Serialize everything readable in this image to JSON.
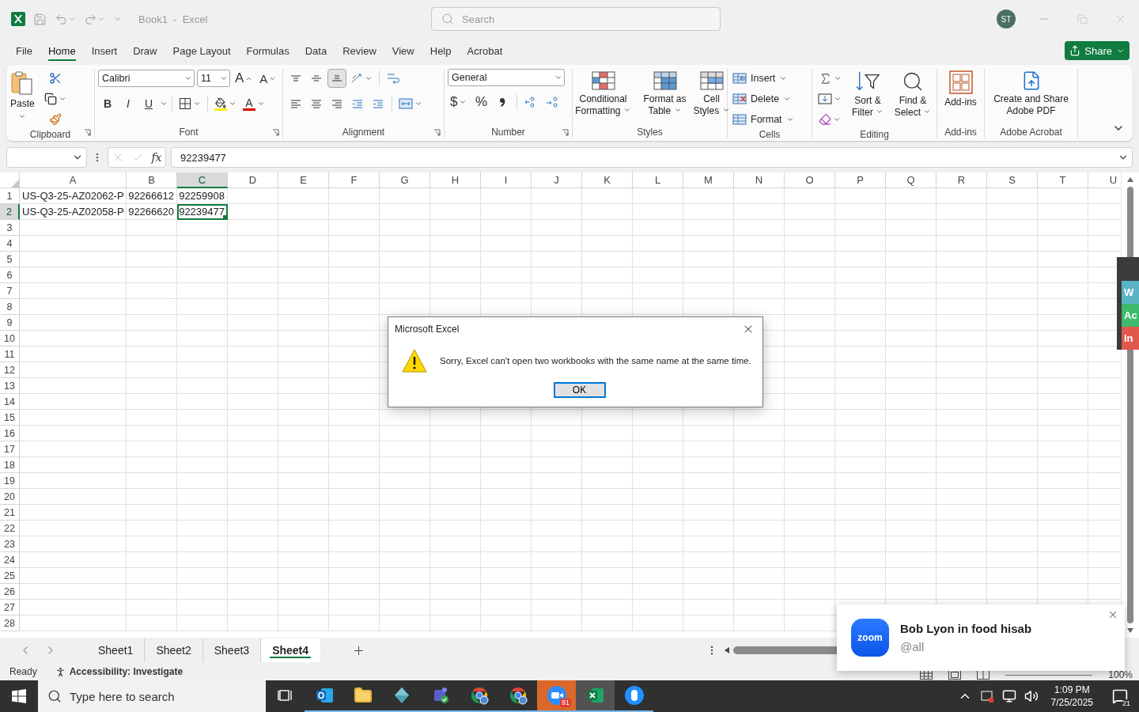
{
  "window": {
    "title": "Book1  -  Excel",
    "search_placeholder": "Search",
    "user_initials": "ST"
  },
  "menu_tabs": [
    {
      "label": "File",
      "selected": false
    },
    {
      "label": "Home",
      "selected": true
    },
    {
      "label": "Insert",
      "selected": false
    },
    {
      "label": "Draw",
      "selected": false
    },
    {
      "label": "Page Layout",
      "selected": false
    },
    {
      "label": "Formulas",
      "selected": false
    },
    {
      "label": "Data",
      "selected": false
    },
    {
      "label": "Review",
      "selected": false
    },
    {
      "label": "View",
      "selected": false
    },
    {
      "label": "Help",
      "selected": false
    },
    {
      "label": "Acrobat",
      "selected": false
    }
  ],
  "share_button": {
    "label": "Share"
  },
  "ribbon": {
    "clipboard": {
      "label": "Clipboard",
      "paste": "Paste"
    },
    "font": {
      "label": "Font",
      "font_name": "Calibri",
      "font_size": "11",
      "grow": "A",
      "shrink": "A",
      "bold": "B",
      "italic": "I",
      "underline": "U",
      "font_color": "A"
    },
    "alignment": {
      "label": "Alignment",
      "vertical": [
        {
          "kind": "top",
          "selected": false
        },
        {
          "kind": "middle",
          "selected": false
        },
        {
          "kind": "bottom",
          "selected": true
        }
      ]
    },
    "number": {
      "label": "Number",
      "format": "General",
      "currency": "$",
      "percent": "%"
    },
    "styles": {
      "label": "Styles",
      "buttons": [
        {
          "kind": "conditional",
          "label": "Conditional Formatting"
        },
        {
          "kind": "table",
          "label": "Format as Table"
        },
        {
          "kind": "cell",
          "label": "Cell Styles"
        }
      ]
    },
    "cells": {
      "label": "Cells",
      "buttons": [
        {
          "kind": "insert",
          "label": "Insert"
        },
        {
          "kind": "delete",
          "label": "Delete"
        },
        {
          "kind": "format",
          "label": "Format"
        }
      ]
    },
    "editing": {
      "label": "Editing",
      "buttons": [
        {
          "kind": "sort",
          "label": "Sort & Filter"
        },
        {
          "kind": "find",
          "label": "Find & Select"
        }
      ]
    },
    "addins": {
      "label": "Add-ins",
      "button": "Add-ins"
    },
    "acrobat": {
      "label": "Adobe Acrobat",
      "button": "Create and Share Adobe PDF"
    }
  },
  "formula_bar": {
    "function_label": "fx",
    "value": "92239477"
  },
  "sheet": {
    "columns": [
      {
        "label": "A",
        "selected": false
      },
      {
        "label": "B",
        "selected": false
      },
      {
        "label": "C",
        "selected": true
      },
      {
        "label": "D",
        "selected": false
      },
      {
        "label": "E",
        "selected": false
      },
      {
        "label": "F",
        "selected": false
      },
      {
        "label": "G",
        "selected": false
      },
      {
        "label": "H",
        "selected": false
      },
      {
        "label": "I",
        "selected": false
      },
      {
        "label": "J",
        "selected": false
      },
      {
        "label": "K",
        "selected": false
      },
      {
        "label": "L",
        "selected": false
      },
      {
        "label": "M",
        "selected": false
      },
      {
        "label": "N",
        "selected": false
      },
      {
        "label": "O",
        "selected": false
      },
      {
        "label": "P",
        "selected": false
      },
      {
        "label": "Q",
        "selected": false
      },
      {
        "label": "R",
        "selected": false
      },
      {
        "label": "S",
        "selected": false
      },
      {
        "label": "T",
        "selected": false
      },
      {
        "label": "U",
        "selected": false
      }
    ],
    "row_numbers": [
      {
        "label": "1",
        "selected": false
      },
      {
        "label": "2",
        "selected": true
      },
      {
        "label": "3",
        "selected": false
      },
      {
        "label": "4",
        "selected": false
      },
      {
        "label": "5",
        "selected": false
      },
      {
        "label": "6",
        "selected": false
      },
      {
        "label": "7",
        "selected": false
      },
      {
        "label": "8",
        "selected": false
      },
      {
        "label": "9",
        "selected": false
      },
      {
        "label": "10",
        "selected": false
      },
      {
        "label": "11",
        "selected": false
      },
      {
        "label": "12",
        "selected": false
      },
      {
        "label": "13",
        "selected": false
      },
      {
        "label": "14",
        "selected": false
      },
      {
        "label": "15",
        "selected": false
      },
      {
        "label": "16",
        "selected": false
      },
      {
        "label": "17",
        "selected": false
      },
      {
        "label": "18",
        "selected": false
      },
      {
        "label": "19",
        "selected": false
      },
      {
        "label": "20",
        "selected": false
      },
      {
        "label": "21",
        "selected": false
      },
      {
        "label": "22",
        "selected": false
      },
      {
        "label": "23",
        "selected": false
      },
      {
        "label": "24",
        "selected": false
      },
      {
        "label": "25",
        "selected": false
      },
      {
        "label": "26",
        "selected": false
      },
      {
        "label": "27",
        "selected": false
      },
      {
        "label": "28",
        "selected": false
      }
    ],
    "rows": [
      {
        "cells": [
          {
            "value": "US-Q3-25-AZ02062-P",
            "kind": "text",
            "selected": false
          },
          {
            "value": "92266612",
            "kind": "number",
            "selected": false
          },
          {
            "value": "92259908",
            "kind": "number",
            "selected": false
          }
        ]
      },
      {
        "cells": [
          {
            "value": "US-Q3-25-AZ02058-P",
            "kind": "text",
            "selected": false
          },
          {
            "value": "92266620",
            "kind": "number",
            "selected": false
          },
          {
            "value": "92239477",
            "kind": "number",
            "selected": true
          }
        ]
      }
    ]
  },
  "sheet_tabs": [
    {
      "label": "Sheet1",
      "selected": false
    },
    {
      "label": "Sheet2",
      "selected": false
    },
    {
      "label": "Sheet3",
      "selected": false
    },
    {
      "label": "Sheet4",
      "selected": true
    }
  ],
  "status_bar": {
    "state": "Ready",
    "accessibility": "Accessibility: Investigate",
    "zoom": "100%"
  },
  "dialog": {
    "title": "Microsoft Excel",
    "message": "Sorry, Excel can't open two workbooks with the same name at the same time.",
    "button": "OK"
  },
  "notification": {
    "app_logo": "zoom",
    "title": "Bob Lyon in food hisab",
    "subtitle": "@all"
  },
  "side_widget": {
    "tabs": [
      {
        "label": "W",
        "color": "#5ab4c6"
      },
      {
        "label": "Ac",
        "color": "#3dba6b"
      },
      {
        "label": "In",
        "color": "#e2574c"
      }
    ]
  },
  "taskbar": {
    "search_placeholder": "Type here to search",
    "apps": [
      {
        "kind": "outlook",
        "selected": false,
        "attention": false
      },
      {
        "kind": "explorer",
        "selected": false,
        "attention": false
      },
      {
        "kind": "diamond",
        "selected": false,
        "attention": false
      },
      {
        "kind": "teams",
        "selected": false,
        "attention": false
      },
      {
        "kind": "chrome",
        "selected": false,
        "attention": false
      },
      {
        "kind": "chrome",
        "selected": false,
        "attention": false
      },
      {
        "kind": "zoom",
        "selected": false,
        "attention": true,
        "badge": "91"
      },
      {
        "kind": "excel",
        "selected": true,
        "attention": false
      },
      {
        "kind": "mouse",
        "selected": false,
        "attention": false
      }
    ],
    "time": "1:09 PM",
    "date": "7/25/2025",
    "notifications": "21"
  }
}
